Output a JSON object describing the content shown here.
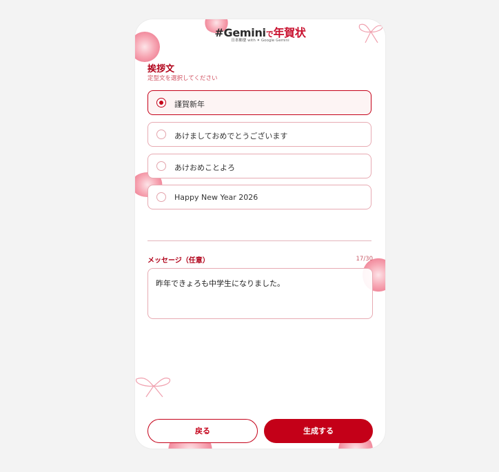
{
  "header": {
    "logo_hash": "#Gemini",
    "logo_de": "で",
    "logo_nenga": "年賀状",
    "logo_sub": "日本郵便 with ✦ Google Gemini"
  },
  "greeting": {
    "title": "挨拶文",
    "subtitle": "定型文を選択してください",
    "options": [
      {
        "label": "謹賀新年",
        "selected": true
      },
      {
        "label": "あけましておめでとうございます",
        "selected": false
      },
      {
        "label": "あけおめことよろ",
        "selected": false
      },
      {
        "label": "Happy New Year 2026",
        "selected": false
      }
    ]
  },
  "message": {
    "label": "メッセージ（任意）",
    "count": "17/30",
    "value": "昨年できょろも中学生になりました。"
  },
  "buttons": {
    "back": "戻る",
    "generate": "生成する"
  },
  "colors": {
    "accent": "#c40018",
    "border": "#e7aab2",
    "selected_bg": "#fdf4f4"
  }
}
